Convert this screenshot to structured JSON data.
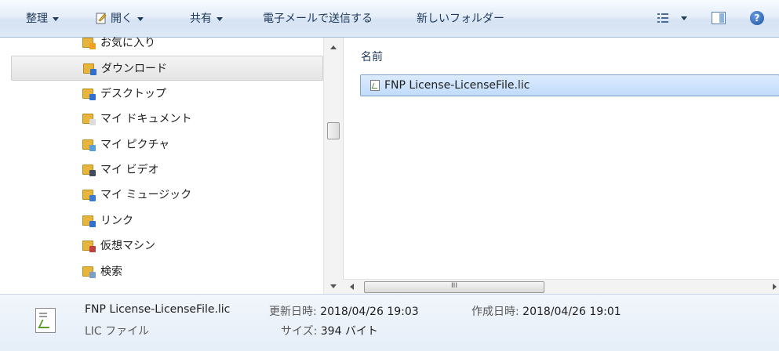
{
  "toolbar": {
    "organize": "整理",
    "open": "開く",
    "share": "共有",
    "email": "電子メールで送信する",
    "new_folder": "新しいフォルダー",
    "help": "?"
  },
  "nav": {
    "items": [
      {
        "label": "お気に入り",
        "icon": "favorites-folder-icon",
        "badge": "#f0a020"
      },
      {
        "label": "ダウンロード",
        "icon": "downloads-folder-icon",
        "badge": "#2e6fd0",
        "selected": true
      },
      {
        "label": "デスクトップ",
        "icon": "desktop-folder-icon",
        "badge": "#2e6fd0"
      },
      {
        "label": "マイ ドキュメント",
        "icon": "documents-folder-icon",
        "badge": "#dcdcdc"
      },
      {
        "label": "マイ ピクチャ",
        "icon": "pictures-folder-icon",
        "badge": "#5aa0d8"
      },
      {
        "label": "マイ ビデオ",
        "icon": "videos-folder-icon",
        "badge": "#404a60"
      },
      {
        "label": "マイ ミュージック",
        "icon": "music-folder-icon",
        "badge": "#3a7ad0"
      },
      {
        "label": "リンク",
        "icon": "links-folder-icon",
        "badge": "#2e6fd0"
      },
      {
        "label": "仮想マシン",
        "icon": "virtual-machines-folder-icon",
        "badge": "#c04040"
      },
      {
        "label": "検索",
        "icon": "searches-folder-icon",
        "badge": "#7aa0c8"
      }
    ]
  },
  "content": {
    "column_header": "名前",
    "files": [
      {
        "name": "FNP License-LicenseFile.lic",
        "icon": "license-file-icon",
        "selected": true
      }
    ],
    "hscroll_grip": "III"
  },
  "details": {
    "file_name": "FNP License-LicenseFile.lic",
    "file_type": "LIC ファイル",
    "modified_label": "更新日時:",
    "modified_value": "2018/04/26 19:03",
    "created_label": "作成日時:",
    "created_value": "2018/04/26 19:01",
    "size_label": "サイズ:",
    "size_value": "394 バイト"
  }
}
